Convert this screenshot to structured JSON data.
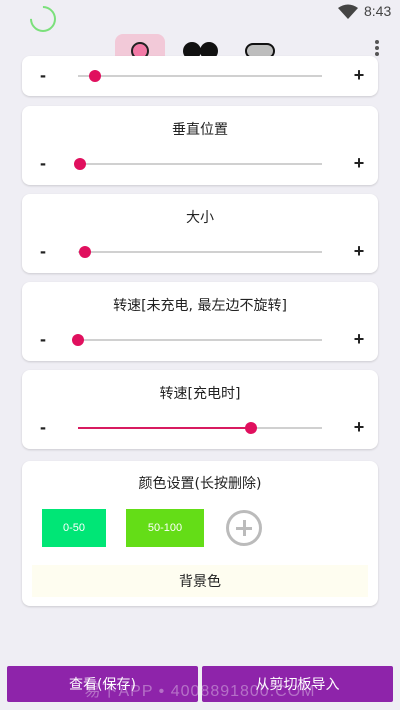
{
  "status": {
    "time": "8:43"
  },
  "cards": {
    "top_partial": {
      "minus": "-",
      "plus": "+",
      "value_pct": 0.07
    },
    "vertical": {
      "title": "垂直位置",
      "minus": "-",
      "plus": "+",
      "value_pct": 0.01
    },
    "size": {
      "title": "大小",
      "minus": "-",
      "plus": "+",
      "value_pct": 0.03
    },
    "speed_no_charge": {
      "title": "转速[未充电, 最左边不旋转]",
      "minus": "-",
      "plus": "+",
      "value_pct": 0.0
    },
    "speed_charging": {
      "title": "转速[充电时]",
      "minus": "-",
      "plus": "+",
      "value_pct": 0.71
    }
  },
  "color_settings": {
    "title": "颜色设置(长按删除)",
    "swatches": [
      {
        "label": "0-50",
        "color": "#00e676"
      },
      {
        "label": "50-100",
        "color": "#64dd17"
      }
    ],
    "background_label": "背景色"
  },
  "bottom": {
    "view_save": "查看(保存)",
    "import_clipboard": "从剪切板导入",
    "watermark": "易下APP • 4008891800.COM"
  },
  "colors": {
    "accent": "#e0105e",
    "button": "#8e24aa"
  }
}
